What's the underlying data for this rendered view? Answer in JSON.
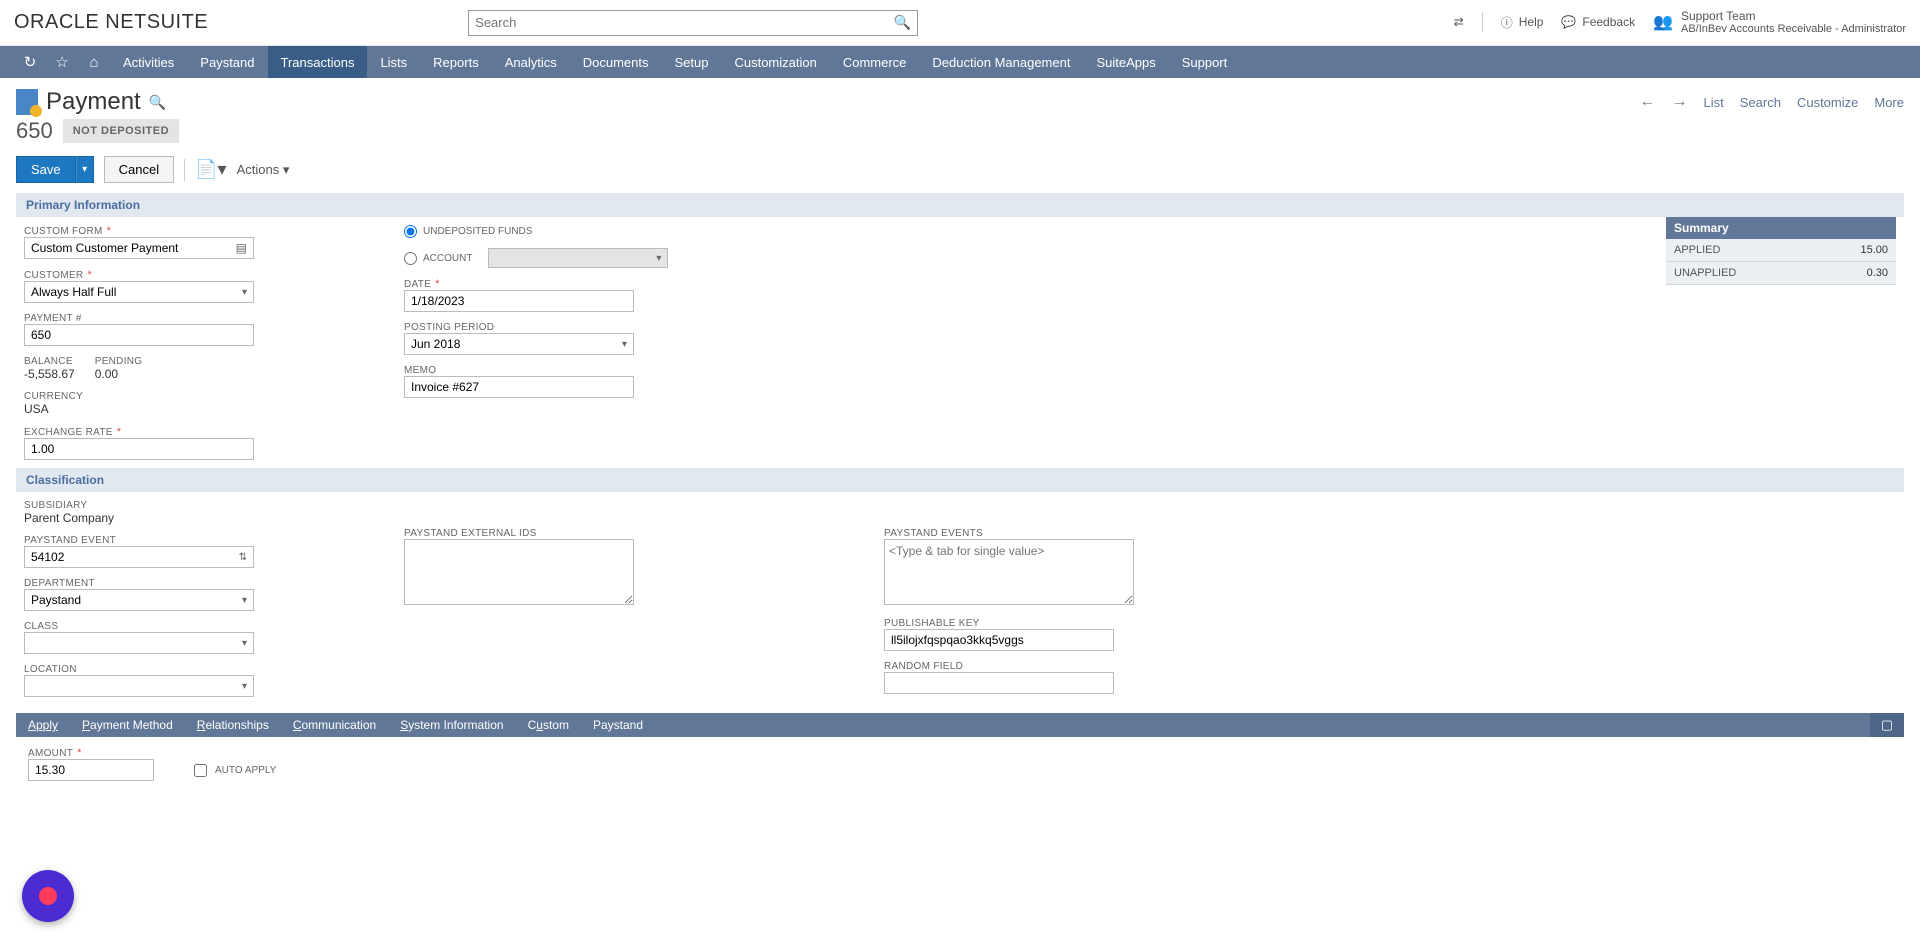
{
  "topbar": {
    "logo_oracle": "ORACLE",
    "logo_ns": "NETSUITE",
    "search_placeholder": "Search",
    "help": "Help",
    "feedback": "Feedback",
    "team": "Support Team",
    "role": "AB/InBev Accounts Receivable - Administrator"
  },
  "nav": {
    "items": [
      "Activities",
      "Paystand",
      "Transactions",
      "Lists",
      "Reports",
      "Analytics",
      "Documents",
      "Setup",
      "Customization",
      "Commerce",
      "Deduction Management",
      "SuiteApps",
      "Support"
    ]
  },
  "page": {
    "title": "Payment",
    "rec_num": "650",
    "status": "NOT DEPOSITED",
    "save": "Save",
    "cancel": "Cancel",
    "actions": "Actions"
  },
  "hdr_right": {
    "list": "List",
    "search": "Search",
    "customize": "Customize",
    "more": "More"
  },
  "sections": {
    "primary": "Primary Information",
    "classification": "Classification"
  },
  "fields": {
    "custom_form_label": "CUSTOM FORM",
    "custom_form_value": "Custom Customer Payment",
    "customer_label": "CUSTOMER",
    "customer_value": "Always Half Full",
    "payment_no_label": "PAYMENT #",
    "payment_no_value": "650",
    "balance_label": "BALANCE",
    "balance_value": "-5,558.67",
    "pending_label": "PENDING",
    "pending_value": "0.00",
    "currency_label": "CURRENCY",
    "currency_value": "USA",
    "exrate_label": "EXCHANGE RATE",
    "exrate_value": "1.00",
    "undeposited": "UNDEPOSITED FUNDS",
    "account_label": "ACCOUNT",
    "date_label": "DATE",
    "date_value": "1/18/2023",
    "period_label": "POSTING PERIOD",
    "period_value": "Jun 2018",
    "memo_label": "MEMO",
    "memo_value": "Invoice #627",
    "subsidiary_label": "SUBSIDIARY",
    "subsidiary_value": "Parent Company",
    "ps_event_label": "PAYSTAND EVENT",
    "ps_event_value": "54102",
    "department_label": "DEPARTMENT",
    "department_value": "Paystand",
    "class_label": "CLASS",
    "location_label": "LOCATION",
    "ps_ext_ids_label": "PAYSTAND EXTERNAL IDS",
    "ps_events_label": "PAYSTAND EVENTS",
    "ps_events_placeholder": "<Type & tab for single value>",
    "pubkey_label": "PUBLISHABLE KEY",
    "pubkey_value": "ll5ilojxfqspqao3kkq5vggs",
    "random_label": "RANDOM FIELD",
    "amount_label": "AMOUNT",
    "amount_value": "15.30",
    "autoapply": "AUTO APPLY"
  },
  "summary": {
    "title": "Summary",
    "applied_label": "APPLIED",
    "applied_value": "15.00",
    "unapplied_label": "UNAPPLIED",
    "unapplied_value": "0.30"
  },
  "tabs": {
    "apply": "Apply",
    "pm_pre": "P",
    "pm_rest": "ayment Method",
    "rel_pre": "R",
    "rel_rest": "elationships",
    "com_pre": "C",
    "com_rest": "ommunication",
    "sys_pre": "S",
    "sys_rest": "ystem Information",
    "cus_pre": "C",
    "cus_mid": "u",
    "cus_rest": "stom",
    "paystand": "Paystand"
  }
}
